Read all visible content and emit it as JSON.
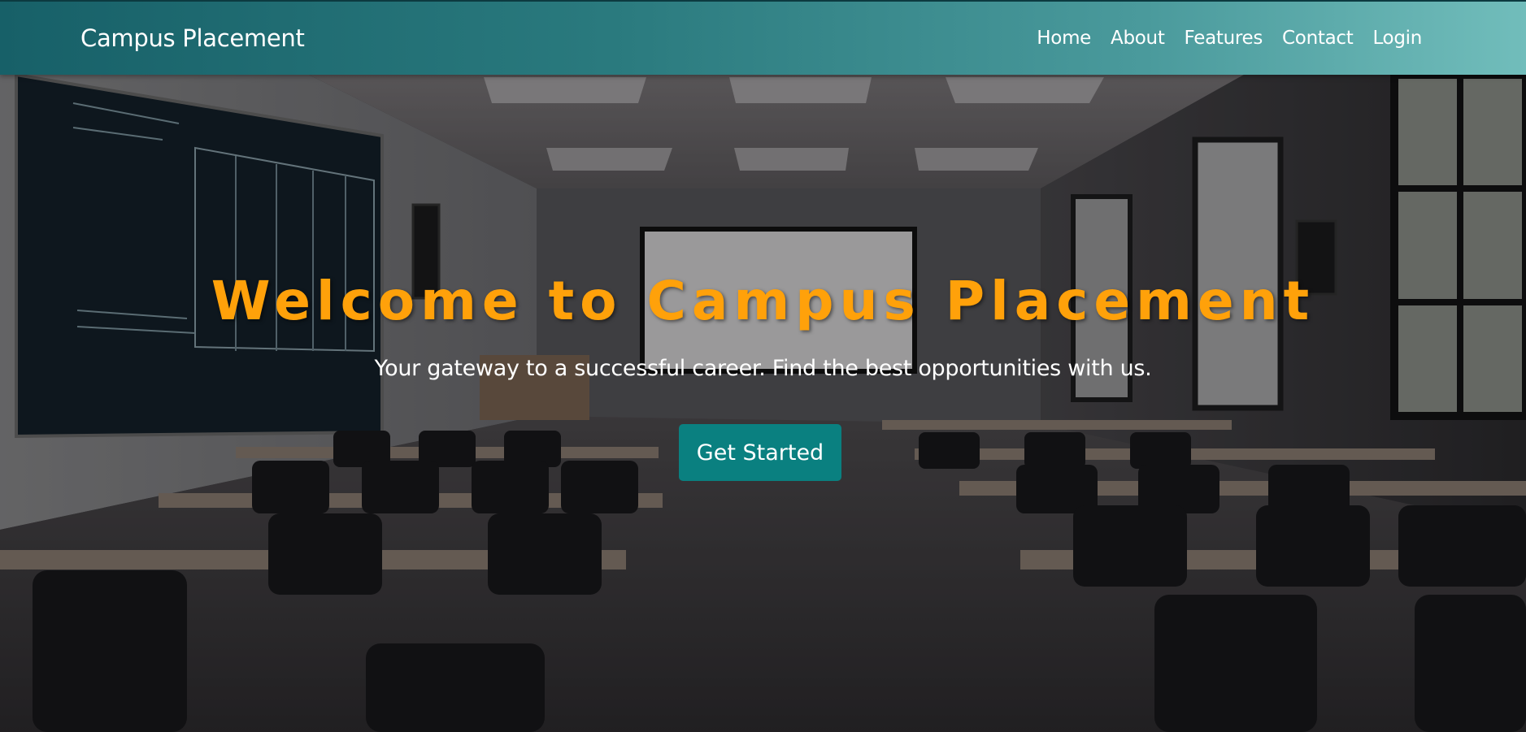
{
  "navbar": {
    "brand": "Campus Placement",
    "links": [
      "Home",
      "About",
      "Features",
      "Contact",
      "Login"
    ]
  },
  "hero": {
    "title": "Welcome to Campus Placement",
    "subtitle": "Your gateway to a successful career. Find the best opportunities with us.",
    "cta_label": "Get Started",
    "background_image": "dark classroom with desks, chairs, chalkboard and windows"
  },
  "colors": {
    "navbar_start": "#176068",
    "navbar_end": "#71bdbb",
    "title": "#ffa10a",
    "cta": "#0a8080"
  }
}
